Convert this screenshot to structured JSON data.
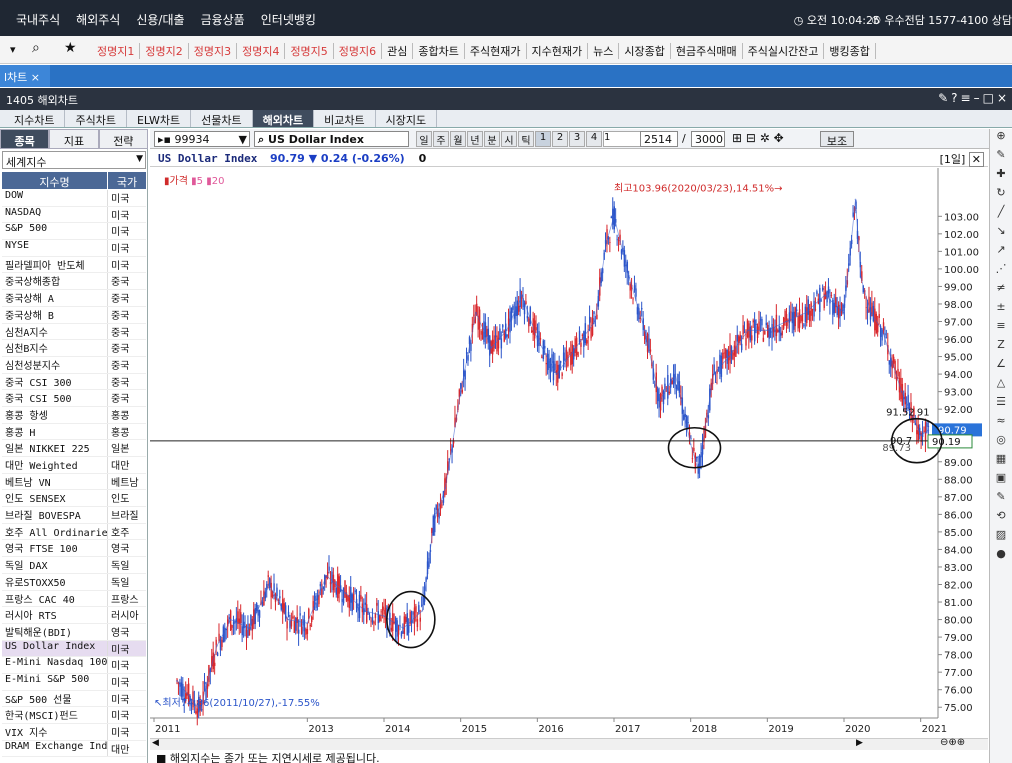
{
  "top_menu": {
    "items": [
      "국내주식",
      "해외주식",
      "신용/대출",
      "금융상품",
      "인터넷뱅킹"
    ],
    "time": "오전 10:04:25",
    "phone": "우수전담 1577-4100 상담"
  },
  "quick_bar": {
    "items": [
      {
        "label": "정명지1",
        "red": true
      },
      {
        "label": "정명지2",
        "red": true
      },
      {
        "label": "정명지3",
        "red": true
      },
      {
        "label": "정명지4",
        "red": true
      },
      {
        "label": "정명지5",
        "red": true
      },
      {
        "label": "정명지6",
        "red": true
      },
      {
        "label": "관심",
        "red": false
      },
      {
        "label": "종합차트",
        "red": false
      },
      {
        "label": "주식현재가",
        "red": false
      },
      {
        "label": "지수현재가",
        "red": false
      },
      {
        "label": "뉴스",
        "red": false
      },
      {
        "label": "시장종합",
        "red": false
      },
      {
        "label": "현금주식매매",
        "red": false
      },
      {
        "label": "주식실시간잔고",
        "red": false
      },
      {
        "label": "뱅킹종합",
        "red": false
      }
    ]
  },
  "doc_tab": "l차트 ×",
  "window_title": "1405 해외차트",
  "chart_tabs": [
    "지수차트",
    "주식차트",
    "ELW차트",
    "선물차트",
    "해외차트",
    "비교차트",
    "시장지도"
  ],
  "active_chart_tab": "해외차트",
  "left_panel": {
    "tabs": [
      "종목",
      "지표",
      "전략"
    ],
    "active_tab": "종목",
    "category": "세계지수",
    "col_name": "지수명",
    "col_country": "국가",
    "rows": [
      {
        "name": "DOW",
        "country": "미국"
      },
      {
        "name": "NASDAQ",
        "country": "미국"
      },
      {
        "name": "S&P 500",
        "country": "미국"
      },
      {
        "name": "NYSE",
        "country": "미국"
      },
      {
        "name": "필라델피아 반도체",
        "country": "미국"
      },
      {
        "name": "중국상해종합",
        "country": "중국"
      },
      {
        "name": "중국상해 A",
        "country": "중국"
      },
      {
        "name": "중국상해 B",
        "country": "중국"
      },
      {
        "name": "심천A지수",
        "country": "중국"
      },
      {
        "name": "심천B지수",
        "country": "중국"
      },
      {
        "name": "심천성분지수",
        "country": "중국"
      },
      {
        "name": "중국 CSI 300",
        "country": "중국"
      },
      {
        "name": "중국 CSI 500",
        "country": "중국"
      },
      {
        "name": "홍콩 항셍",
        "country": "홍콩"
      },
      {
        "name": "홍콩 H",
        "country": "홍콩"
      },
      {
        "name": "일본 NIKKEI 225",
        "country": "일본"
      },
      {
        "name": "대만 Weighted",
        "country": "대만"
      },
      {
        "name": "베트남 VN",
        "country": "베트남"
      },
      {
        "name": "인도 SENSEX",
        "country": "인도"
      },
      {
        "name": "브라질 BOVESPA",
        "country": "브라질"
      },
      {
        "name": "호주 All Ordinaries",
        "country": "호주"
      },
      {
        "name": "영국 FTSE 100",
        "country": "영국"
      },
      {
        "name": "독일 DAX",
        "country": "독일"
      },
      {
        "name": "유로STOXX50",
        "country": "독일"
      },
      {
        "name": "프랑스 CAC 40",
        "country": "프랑스"
      },
      {
        "name": "러시아 RTS",
        "country": "러시아"
      },
      {
        "name": "발틱해운(BDI)",
        "country": "영국"
      },
      {
        "name": "US Dollar Index",
        "country": "미국"
      },
      {
        "name": "E-Mini Nasdaq 100",
        "country": "미국"
      },
      {
        "name": "E-Mini S&P 500",
        "country": "미국"
      },
      {
        "name": "S&P 500 선물",
        "country": "미국"
      },
      {
        "name": "한국(MSCI)펀드",
        "country": "미국"
      },
      {
        "name": "VIX 지수",
        "country": "미국"
      },
      {
        "name": "DRAM Exchange Index",
        "country": "대만"
      }
    ],
    "selected_index": 27
  },
  "chart_toolbar": {
    "code": "99934",
    "symbol_name": "US Dollar Index",
    "periods": [
      "일",
      "주",
      "월",
      "년",
      "분",
      "시",
      "틱"
    ],
    "multipliers": [
      "1",
      "2",
      "3",
      "4"
    ],
    "selected_multiplier": "1",
    "unit_value": "1",
    "count": "2514",
    "max_count": "3000",
    "assist_label": "보조"
  },
  "info_line": {
    "symbol": "US Dollar Index",
    "price": "90.79",
    "change": "▼ 0.24",
    "change_pct": "(-0.26%)",
    "volume": "0",
    "period_tag": "[1일]"
  },
  "legend": {
    "price": "가격",
    "ma5": "5",
    "ma20": "20"
  },
  "status_text": "■ 해외지수는 종가 또는 지연시세로 제공됩니다.",
  "chart_data": {
    "type": "line",
    "title": "US Dollar Index",
    "x_labels": [
      "2011",
      "2013",
      "2014",
      "2015",
      "2016",
      "2017",
      "2018",
      "2019",
      "2020",
      "2021"
    ],
    "y_ticks": [
      75.0,
      76.0,
      77.0,
      78.0,
      79.0,
      80.0,
      81.0,
      82.0,
      83.0,
      84.0,
      85.0,
      86.0,
      87.0,
      88.0,
      89.0,
      90.0,
      91.0,
      92.0,
      93.0,
      94.0,
      95.0,
      96.0,
      97.0,
      98.0,
      99.0,
      100.0,
      101.0,
      102.0,
      103.0
    ],
    "ylim": [
      74.5,
      104.5
    ],
    "current_price": 90.79,
    "crosshair_value": 90.19,
    "high_label": "최고103.96(2020/03/23),14.51%",
    "low_label": "최저74.86(2011/10/27),-17.55%",
    "annotation_a": "91.52",
    "annotation_b": "91",
    "annotation_c": "90.7",
    "annotation_d": "89.73",
    "x": [
      2011.3,
      2011.6,
      2011.82,
      2012.0,
      2012.25,
      2012.5,
      2012.75,
      2013.0,
      2013.25,
      2013.5,
      2013.75,
      2014.0,
      2014.25,
      2014.5,
      2014.65,
      2014.8,
      2015.0,
      2015.2,
      2015.4,
      2015.6,
      2015.8,
      2016.0,
      2016.25,
      2016.5,
      2016.75,
      2016.9,
      2017.0,
      2017.2,
      2017.4,
      2017.6,
      2017.8,
      2018.0,
      2018.1,
      2018.3,
      2018.5,
      2018.75,
      2019.0,
      2019.25,
      2019.5,
      2019.75,
      2020.0,
      2020.15,
      2020.22,
      2020.35,
      2020.5,
      2020.75,
      2020.9,
      2021.0,
      2021.1
    ],
    "values": [
      76.5,
      74.86,
      78.5,
      80.0,
      79.5,
      82.0,
      80.0,
      79.8,
      82.5,
      81.5,
      80.5,
      80.2,
      79.5,
      80.5,
      85.5,
      87.5,
      93.0,
      97.5,
      95.5,
      96.5,
      98.5,
      96.0,
      94.0,
      95.5,
      97.0,
      101.5,
      103.0,
      99.5,
      96.5,
      92.5,
      94.0,
      90.0,
      88.5,
      94.0,
      95.0,
      96.5,
      96.5,
      97.0,
      97.5,
      98.5,
      97.5,
      103.96,
      99.5,
      97.5,
      96.5,
      93.0,
      91.5,
      90.5,
      90.79
    ]
  }
}
